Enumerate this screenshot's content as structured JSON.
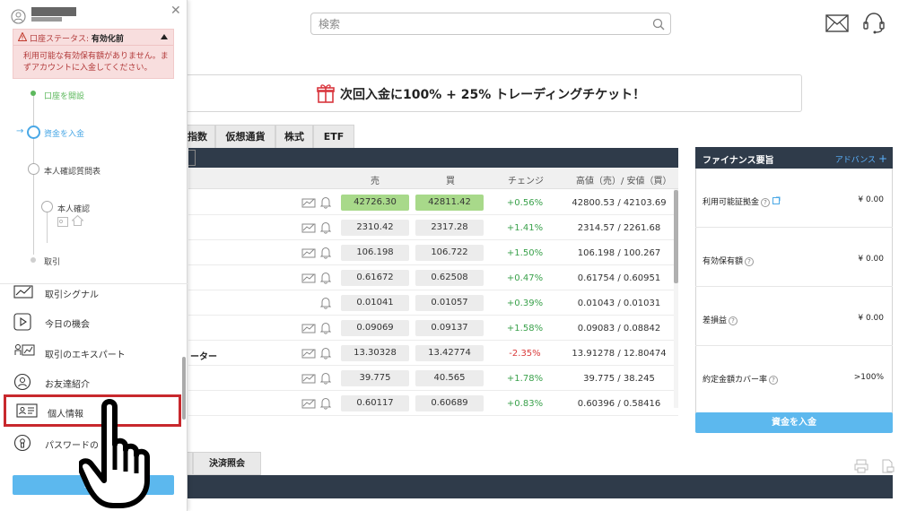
{
  "header": {
    "search_placeholder": "検索",
    "icons": [
      "search-icon",
      "mail-icon",
      "support-headset-icon"
    ]
  },
  "promo": {
    "text": "次回入金に100% + 25% トレーディングチケット！",
    "icon": "gift-icon"
  },
  "tabs": [
    {
      "label": "指数"
    },
    {
      "label": "仮想通貨"
    },
    {
      "label": "株式"
    },
    {
      "label": "ETF"
    }
  ],
  "table": {
    "columns": {
      "sell": "売",
      "buy": "買",
      "change": "チェンジ",
      "range": "高値（売）/ 安値（買）"
    },
    "rows": [
      {
        "name": "",
        "sell": "42726.30",
        "buy": "42811.42",
        "change": "+0.56%",
        "range": "42800.53 / 42103.69",
        "highlight": true,
        "chart_icon": true
      },
      {
        "name": "",
        "sell": "2310.42",
        "buy": "2317.28",
        "change": "+1.41%",
        "range": "2314.57 / 2261.68",
        "highlight": false,
        "chart_icon": true
      },
      {
        "name": "",
        "sell": "106.198",
        "buy": "106.722",
        "change": "+1.50%",
        "range": "106.198 / 100.267",
        "highlight": false,
        "chart_icon": true
      },
      {
        "name": "",
        "sell": "0.61672",
        "buy": "0.62508",
        "change": "+0.47%",
        "range": "0.61754 / 0.60951",
        "highlight": false,
        "chart_icon": true
      },
      {
        "name": "",
        "sell": "0.01041",
        "buy": "0.01057",
        "change": "+0.39%",
        "range": "0.01043 / 0.01031",
        "highlight": false,
        "chart_icon": false
      },
      {
        "name": "",
        "sell": "0.09069",
        "buy": "0.09137",
        "change": "+1.58%",
        "range": "0.09083 / 0.08842",
        "highlight": false,
        "chart_icon": true
      },
      {
        "name": "ーター",
        "sell": "13.30328",
        "buy": "13.42774",
        "change": "-2.35%",
        "range": "13.91278 / 12.80474",
        "highlight": false,
        "chart_icon": true
      },
      {
        "name": "",
        "sell": "39.775",
        "buy": "40.565",
        "change": "+1.78%",
        "range": "39.775 / 38.245",
        "highlight": false,
        "chart_icon": true
      },
      {
        "name": "",
        "sell": "0.60117",
        "buy": "0.60689",
        "change": "+0.83%",
        "range": "0.60396 / 0.58416",
        "highlight": false,
        "chart_icon": true
      }
    ]
  },
  "finance": {
    "title": "ファイナンス要旨",
    "advanced": "アドバンス",
    "rows": [
      {
        "label": "利用可能証拠金",
        "value": "¥ 0.00"
      },
      {
        "label": "有効保有額",
        "value": "¥ 0.00"
      },
      {
        "label": "差損益",
        "value": "¥ 0.00"
      },
      {
        "label": "約定金額カバー率",
        "value": ">100%"
      }
    ],
    "deposit_button": "資金を入金"
  },
  "bottom": {
    "tab_label": "決済照会"
  },
  "sidebar": {
    "alert_title_prefix": "口座ステータス: ",
    "alert_title_status": "有効化前",
    "alert_message": "利用可能な有効保有額がありません。まずアカウントに入金してください。",
    "steps": [
      {
        "label": "口座を開設"
      },
      {
        "label": "資金を入金"
      },
      {
        "label": "本人確認質問表"
      },
      {
        "label": "本人確認"
      },
      {
        "label": "取引"
      }
    ],
    "menu": [
      {
        "label": "取引シグナル",
        "icon": "signal-chart-icon"
      },
      {
        "label": "今日の機会",
        "icon": "play-icon"
      },
      {
        "label": "取引のエキスパート",
        "icon": "expert-chart-icon"
      },
      {
        "label": "お友達紹介",
        "icon": "referral-icon"
      },
      {
        "label": "個人情報",
        "icon": "id-card-icon"
      },
      {
        "label": "パスワードの",
        "icon": "password-icon"
      }
    ],
    "button_label": "資金"
  },
  "colors": {
    "accent_blue": "#5cb8ee",
    "dark_header": "#2f3b4a",
    "positive": "#3aa14b",
    "negative": "#d93a3a",
    "highlight_green": "#a8d98a",
    "selected_border": "#c8282d",
    "alert_bg": "#f8dede"
  }
}
